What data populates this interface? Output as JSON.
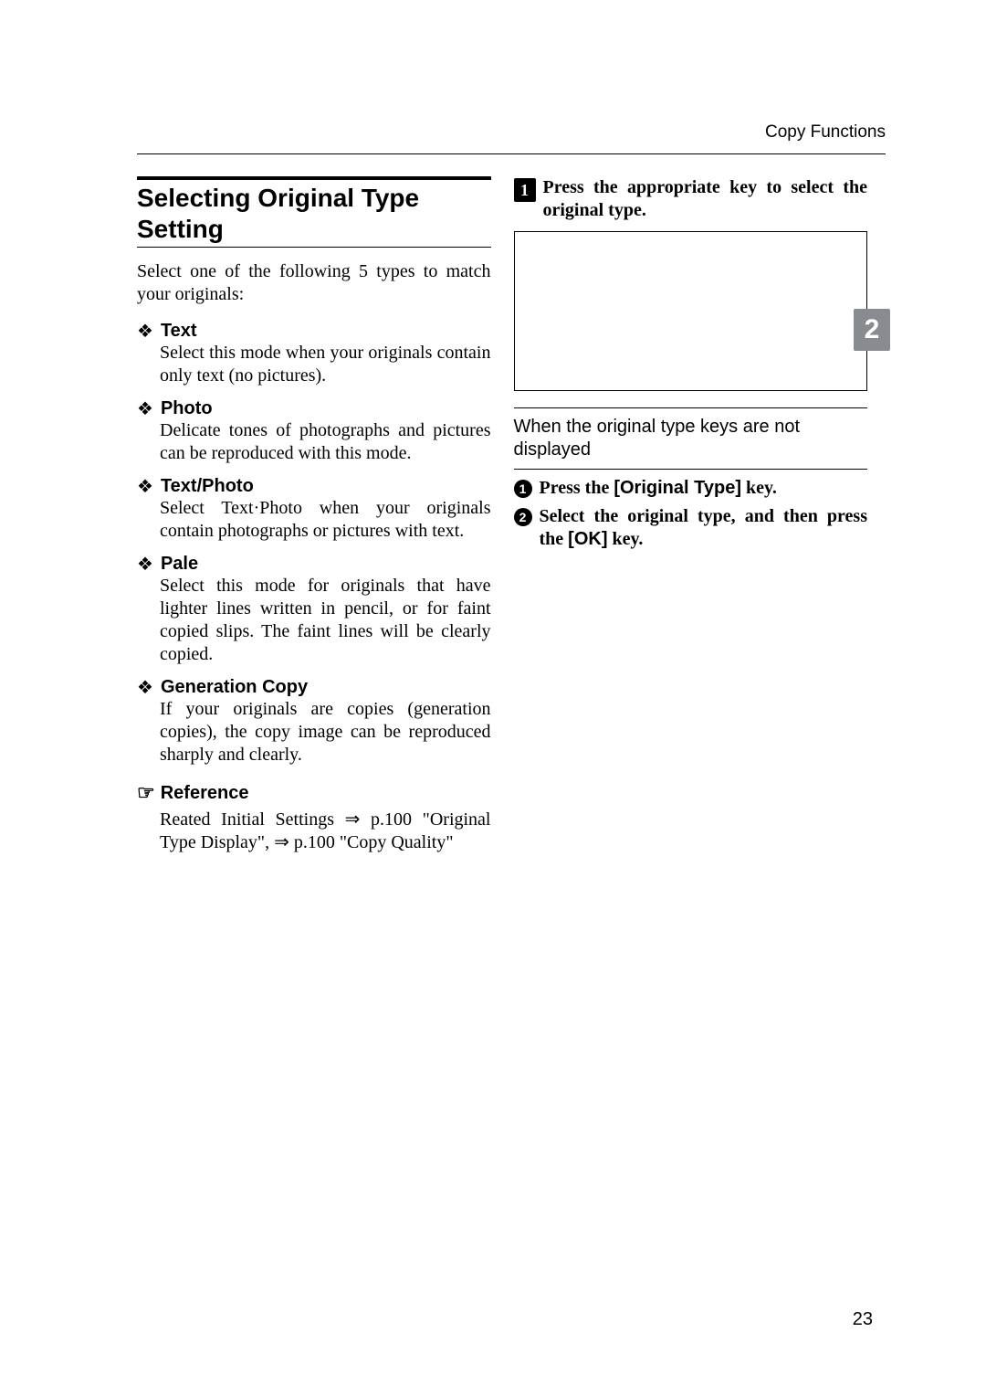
{
  "header": {
    "section": "Copy Functions"
  },
  "left": {
    "title": "Selecting Original Type Setting",
    "intro": "Select one of the following 5 types to match your originals:",
    "items": [
      {
        "title": "Text",
        "body": "Select this mode when your originals contain only text (no pictures)."
      },
      {
        "title": "Photo",
        "body": "Delicate tones of photographs and pictures can be reproduced with this mode."
      },
      {
        "title": "Text/Photo",
        "body": "Select Text·Photo when your originals contain photographs or pictures with text."
      },
      {
        "title": "Pale",
        "body": "Select this mode for originals that have lighter lines written in pencil, or for faint copied slips. The faint lines will be clearly copied."
      },
      {
        "title": "Generation Copy",
        "body": "If your originals are copies (generation copies), the copy image can be reproduced sharply and clearly."
      }
    ],
    "reference": {
      "label": "Reference",
      "body": "Reated Initial Settings ⇒ p.100 \"Original Type Display\", ⇒ p.100 \"Copy Quality\""
    }
  },
  "right": {
    "step1": {
      "num": "1",
      "text": "Press the appropriate key to select the original type."
    },
    "subsection_title": "When the original type keys are not displayed",
    "sub1": {
      "num": "1",
      "before": "Press the ",
      "key": "[Original Type]",
      "after": " key."
    },
    "sub2": {
      "num": "2",
      "before": "Select the original type, and then press the ",
      "key": "[OK]",
      "after": " key."
    }
  },
  "tab": {
    "chapter": "2"
  },
  "footer": {
    "page": "23"
  }
}
